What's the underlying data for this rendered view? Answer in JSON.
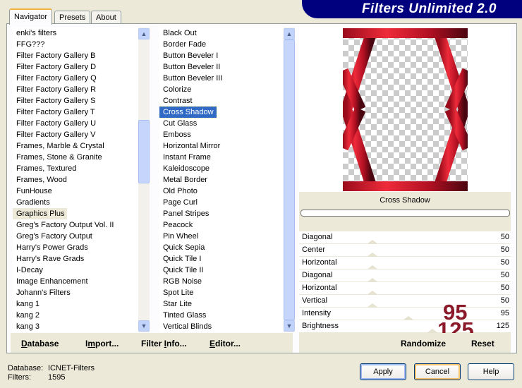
{
  "app": {
    "title": "Filters Unlimited 2.0"
  },
  "tabs": [
    {
      "label": "Navigator",
      "active": true
    },
    {
      "label": "Presets"
    },
    {
      "label": "About"
    }
  ],
  "categories": {
    "items": [
      "enki's filters",
      "FFG???",
      "Filter Factory Gallery B",
      "Filter Factory Gallery D",
      "Filter Factory Gallery Q",
      "Filter Factory Gallery R",
      "Filter Factory Gallery S",
      "Filter Factory Gallery T",
      "Filter Factory Gallery U",
      "Filter Factory Gallery V",
      "Frames, Marble & Crystal",
      "Frames, Stone & Granite",
      "Frames, Textured",
      "Frames, Wood",
      "FunHouse",
      "Gradients",
      "Graphics Plus",
      "Greg's Factory Output Vol. II",
      "Greg's Factory Output",
      "Harry's Power Grads",
      "Harry's Rave Grads",
      "I-Decay",
      "Image Enhancement",
      "Johann's Filters",
      "kang 1",
      "kang 2",
      "kang 3"
    ],
    "selected": "Graphics Plus"
  },
  "filters": {
    "items": [
      "Black Out",
      "Border Fade",
      "Button Beveler I",
      "Button Beveler II",
      "Button Beveler III",
      "Colorize",
      "Contrast",
      "Cross Shadow",
      "Cut Glass",
      "Emboss",
      "Horizontal Mirror",
      "Instant Frame",
      "Kaleidoscope",
      "Metal Border",
      "Old Photo",
      "Page Curl",
      "Panel Stripes",
      "Peacock",
      "Pin Wheel",
      "Quick Sepia",
      "Quick Tile I",
      "Quick Tile II",
      "RGB Noise",
      "Spot Lite",
      "Star Lite",
      "Tinted Glass",
      "Vertical Blinds"
    ],
    "selected": "Cross Shadow"
  },
  "preview": {
    "filter_name": "Cross Shadow",
    "progress": 0
  },
  "sliders": [
    {
      "label": "Diagonal",
      "value": 50,
      "max": 255
    },
    {
      "label": "Center",
      "value": 50,
      "max": 255
    },
    {
      "label": "Horizontal",
      "value": 50,
      "max": 255
    },
    {
      "label": "Diagonal",
      "value": 50,
      "max": 255
    },
    {
      "label": "Horizontal",
      "value": 50,
      "max": 255
    },
    {
      "label": "Vertical",
      "value": 50,
      "max": 255
    },
    {
      "label": "Intensity",
      "value": 95,
      "max": 255
    },
    {
      "label": "Brightness",
      "value": 125,
      "max": 255
    }
  ],
  "annotations": {
    "intensity": "95",
    "brightness": "125",
    "color": "#8b1a2a"
  },
  "bottom_bar": {
    "database": "Database",
    "import": "Import...",
    "filter_info": "Filter Info...",
    "editor": "Editor...",
    "randomize": "Randomize",
    "reset": "Reset"
  },
  "status": {
    "database_label": "Database:",
    "database_value": "ICNET-Filters",
    "filters_label": "Filters:",
    "filters_value": "1595"
  },
  "buttons": {
    "apply": "Apply",
    "cancel": "Cancel",
    "help": "Help"
  }
}
